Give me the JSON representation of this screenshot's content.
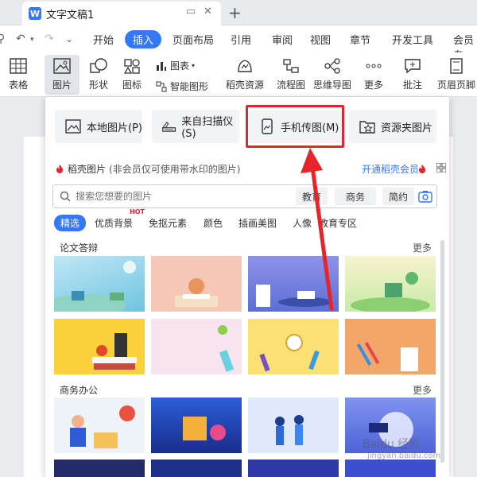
{
  "window": {
    "doc_title": "文字文稿1"
  },
  "menu": {
    "items": [
      "开始",
      "插入",
      "页面布局",
      "引用",
      "审阅",
      "视图",
      "章节",
      "开发工具",
      "会员专"
    ],
    "active": "插入"
  },
  "ribbon": {
    "table": "表格",
    "picture": "图片",
    "shape": "形状",
    "icon": "图标",
    "chart": "图表",
    "smart": "智能图形",
    "docer": "稻壳资源",
    "flow": "流程图",
    "mind": "思维导图",
    "more": "更多",
    "comment": "批注",
    "header": "页眉页脚"
  },
  "panel": {
    "sources": {
      "local": "本地图片(P)",
      "scanner": "来自扫描仪(S)",
      "phone": "手机传图(M)",
      "folder": "资源夹图片"
    },
    "stock": {
      "title": "稻壳图片",
      "note": "(非会员仅可使用带水印的图片)",
      "vip_link": "开通稻壳会员"
    },
    "search": {
      "placeholder": "搜索您想要的图片",
      "tags": [
        "教育",
        "商务",
        "简约"
      ]
    },
    "categories": [
      "精选",
      "优质背景",
      "免抠元素",
      "颜色",
      "插画美图",
      "人像",
      "教育专区"
    ],
    "hot_badge": "HOT",
    "sections": [
      {
        "title": "论文答辩",
        "more": "更多"
      },
      {
        "title": "商务办公",
        "more": "更多"
      }
    ]
  },
  "watermark": {
    "brand": "Baidu 经验",
    "url": "jingyan.baidu.com"
  },
  "colors": {
    "accent": "#3478f6",
    "highlight": "#e5252a"
  }
}
